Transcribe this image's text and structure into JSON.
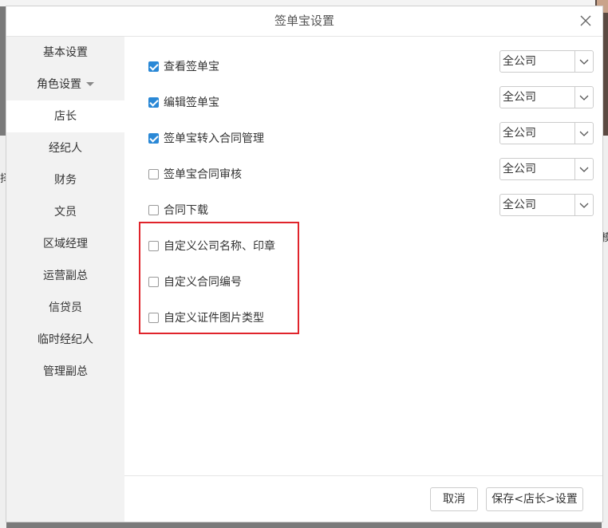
{
  "dialog": {
    "title": "签单宝设置"
  },
  "sidebar": {
    "items": [
      {
        "label": "基本设置"
      },
      {
        "label": "角色设置"
      },
      {
        "label": "店长"
      },
      {
        "label": "经纪人"
      },
      {
        "label": "财务"
      },
      {
        "label": "文员"
      },
      {
        "label": "区域经理"
      },
      {
        "label": "运营副总"
      },
      {
        "label": "信贷员"
      },
      {
        "label": "临时经纪人"
      },
      {
        "label": "管理副总"
      }
    ],
    "active": "店长"
  },
  "permissions": [
    {
      "label": "查看签单宝",
      "checked": true,
      "scope": "全公司"
    },
    {
      "label": "编辑签单宝",
      "checked": true,
      "scope": "全公司"
    },
    {
      "label": "签单宝转入合同管理",
      "checked": true,
      "scope": "全公司"
    },
    {
      "label": "签单宝合同审核",
      "checked": false,
      "scope": "全公司"
    },
    {
      "label": "合同下载",
      "checked": false,
      "scope": "全公司"
    },
    {
      "label": "自定义公司名称、印章",
      "checked": false
    },
    {
      "label": "自定义合同编号",
      "checked": false
    },
    {
      "label": "自定义证件图片类型",
      "checked": false
    }
  ],
  "footer": {
    "cancel_label": "取消",
    "save_label": "保存<店长>设置"
  },
  "colors": {
    "accent": "#2a88d6",
    "highlight": "#e0242b"
  },
  "background": {
    "left_fragment": "择",
    "right_fragment": "模"
  }
}
